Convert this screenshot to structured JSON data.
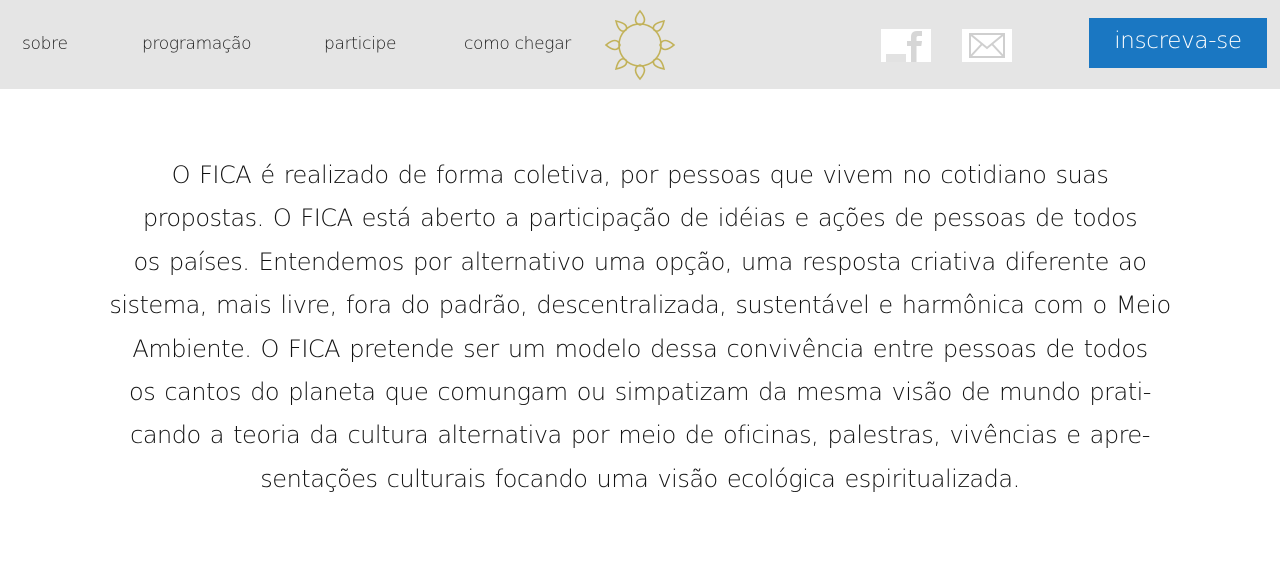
{
  "nav": {
    "items": [
      {
        "label": "sobre"
      },
      {
        "label": "programação"
      },
      {
        "label": "participe"
      },
      {
        "label": "como chegar"
      }
    ]
  },
  "logo": {
    "icon": "lotus-mandala-icon",
    "color": "#c2b25a"
  },
  "social": {
    "facebook_icon": "facebook-icon",
    "email_icon": "envelope-icon"
  },
  "cta": {
    "label": "inscreva-se",
    "color": "#1a77c2"
  },
  "body": {
    "lines": [
      "O FICA é realizado de forma coletiva, por pessoas que vivem no cotidiano suas",
      "propostas. O FICA está aberto a participação de idéias e ações de pessoas de todos",
      "os países. Entendemos por alternativo uma opção, uma resposta criativa diferente ao",
      "sistema, mais livre, fora do padrão, descentralizada, sustentável e harmônica com o Meio",
      "Ambiente. O FICA pretende ser um modelo dessa convivência entre pessoas de todos",
      "os cantos do planeta que comungam ou simpatizam da mesma visão de mundo prati-",
      "cando a teoria da cultura alternativa por meio de oficinas, palestras, vivências e apre-",
      "sentações culturais focando uma visão ecológica espiritualizada."
    ]
  }
}
